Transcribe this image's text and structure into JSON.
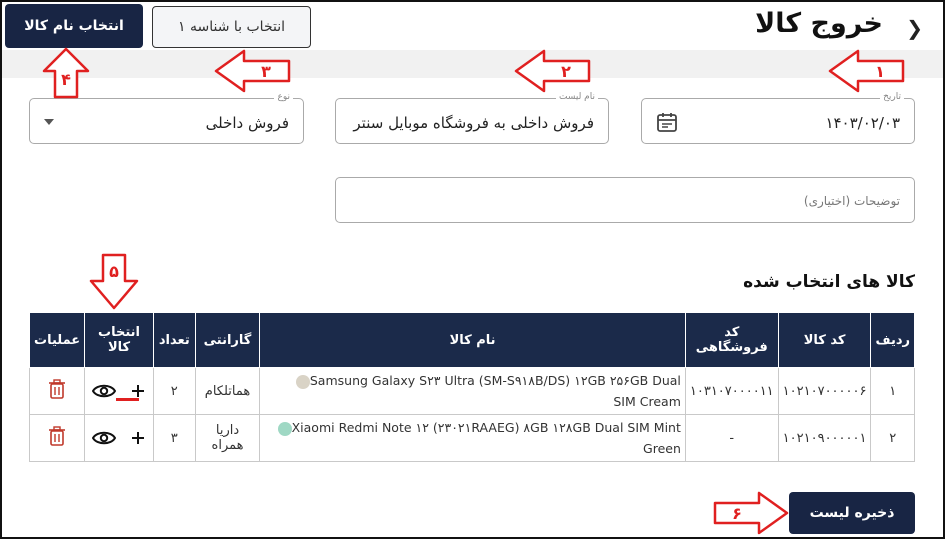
{
  "header": {
    "title": "خروج کالا",
    "back_icon": "chevron-right-icon",
    "buttons": {
      "select_by_id": "انتخاب با شناسه ۱",
      "select_by_name": "انتخاب نام کالا"
    }
  },
  "form": {
    "date": {
      "label": "تاریخ",
      "value": "۱۴۰۳/۰۲/۰۳",
      "icon": "calendar-icon"
    },
    "list_name": {
      "label": "نام لیست",
      "value": "فروش داخلی به فروشگاه موبایل سنتر"
    },
    "type": {
      "label": "نوع",
      "value": "فروش داخلی"
    },
    "notes": {
      "placeholder": "توضیحات (اختیاری)"
    }
  },
  "section_title": "کالا های انتخاب شده",
  "table": {
    "headers": {
      "row": "ردیف",
      "code": "کد کالا",
      "store_code": "کد فروشگاهی",
      "name": "نام کالا",
      "warranty": "گارانتی",
      "qty": "تعداد",
      "select": "انتخاب کالا",
      "ops": "عملیات"
    },
    "rows": [
      {
        "row": "۱",
        "code": "۱۰۲۱۰۷۰۰۰۰۰۶",
        "store_code": "۱۰۳۱۰۷۰۰۰۰۱۱",
        "name": "Samsung Galaxy S۲۳ Ultra (SM-S۹۱۸B/DS) ۱۲GB ۲۵۶GB Dual SIM Cream",
        "color": "#d9d3c6",
        "warranty": "هماتلکام",
        "qty": "۲"
      },
      {
        "row": "۲",
        "code": "۱۰۲۱۰۹۰۰۰۰۰۱",
        "store_code": "-",
        "name": "Xiaomi Redmi Note ۱۲ (۲۳۰۲۱RAAEG) ۸GB ۱۲۸GB Dual SIM Mint Green",
        "color": "#9fd8c4",
        "warranty": "داریا همراه",
        "qty": "۳"
      }
    ]
  },
  "save_button": "ذخیره لیست",
  "annotations": [
    "۱",
    "۲",
    "۳",
    "۴",
    "۵",
    "۶"
  ],
  "colors": {
    "primary": "#182544",
    "annotation_red": "#e02020",
    "delete_red": "#c0392b"
  }
}
